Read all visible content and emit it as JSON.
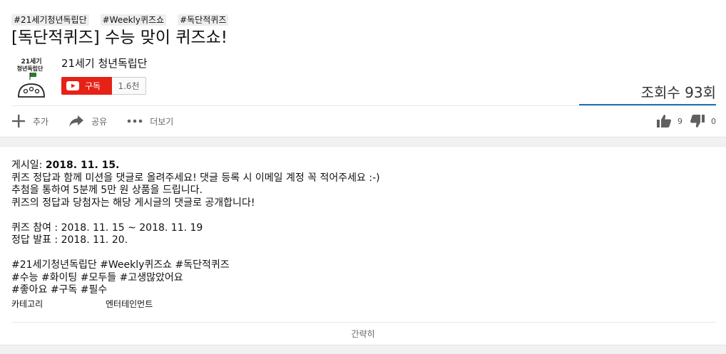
{
  "tags": [
    "#21세기청년독립단",
    "#Weekly퀴즈쇼",
    "#독단적퀴즈"
  ],
  "title": "[독단적퀴즈] 수능 맞이 퀴즈쇼!",
  "channel": {
    "name": "21세기 청년독립단",
    "avatar_text_line1": "21세기",
    "avatar_text_line2": "청년독립단",
    "subscribe_label": "구독",
    "subscriber_count": "1.6천"
  },
  "views": "조회수 93회",
  "actions": {
    "add": "추가",
    "share": "공유",
    "more": "더보기"
  },
  "rating": {
    "likes": "9",
    "dislikes": "0"
  },
  "description": {
    "published_label": "게시일: ",
    "published_date": "2018. 11. 15.",
    "lines": [
      "퀴즈 정답과 함께 미션을 댓글로 올려주세요! 댓글 등록 시 이메일 계정 꼭 적어주세요 :-)",
      "추첨을 통하여 5분께 5만 원 상품을 드립니다.",
      "퀴즈의 정답과 당첨자는 해당 게시글의 댓글로 공개합니다!"
    ],
    "schedule": [
      "퀴즈 참여 : 2018. 11. 15 ~ 2018. 11. 19",
      "정답 발표 : 2018. 11. 20."
    ],
    "hashtags": [
      "#21세기청년독립단 #Weekly퀴즈쇼 #독단적퀴즈",
      "#수능 #화이팅 #모두들 #고생많았어요",
      "#좋아요 #구독 #필수"
    ]
  },
  "meta": {
    "category_label": "카테고리",
    "category_value": "엔터테인먼트"
  },
  "collapse_label": "간략히",
  "colors": {
    "subscribe": "#e62117",
    "views_bar": "#1f6fb2",
    "icon": "#606060"
  }
}
